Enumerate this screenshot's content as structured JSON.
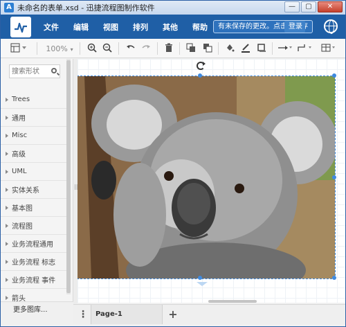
{
  "window": {
    "title": "未命名的表单.xsd - 迅捷流程图制作软件",
    "minimize_label": "—",
    "maximize_label": "▢",
    "close_label": "✕"
  },
  "menubar": {
    "logo_icon": "app-logo-icon",
    "items": [
      {
        "label": "文件"
      },
      {
        "label": "编辑"
      },
      {
        "label": "视图"
      },
      {
        "label": "排列"
      },
      {
        "label": "其他"
      },
      {
        "label": "帮助"
      }
    ],
    "unsaved_notice": "有未保存的更改。点击我保存",
    "login_label": "登录",
    "globe_icon": "globe-icon"
  },
  "toolbar": {
    "zoom_level": "100%",
    "icons": [
      "page-layout-icon",
      "zoom-in-icon",
      "zoom-out-icon",
      "undo-icon",
      "redo-icon",
      "delete-icon",
      "to-front-icon",
      "to-back-icon",
      "fill-color-icon",
      "line-color-icon",
      "shadow-icon",
      "connector-icon",
      "waypoint-icon",
      "table-icon"
    ]
  },
  "sidebar": {
    "search_placeholder": "搜索形状",
    "libraries": [
      {
        "label": "Trees"
      },
      {
        "label": "通用"
      },
      {
        "label": "Misc"
      },
      {
        "label": "高级"
      },
      {
        "label": "UML"
      },
      {
        "label": "实体关系"
      },
      {
        "label": "基本图"
      },
      {
        "label": "流程图"
      },
      {
        "label": "业务流程通用"
      },
      {
        "label": "业务流程 标志"
      },
      {
        "label": "业务流程 事件"
      },
      {
        "label": "箭头"
      }
    ],
    "more_libraries": "更多图库..."
  },
  "canvas": {
    "selected_shape": "koala-photo"
  },
  "tabbar": {
    "menu_label": "⋮",
    "page_tab": "Page-1",
    "add_label": "+"
  },
  "colors": {
    "menubar_bg": "#1f5fa6",
    "selection": "#3f8ae0"
  }
}
